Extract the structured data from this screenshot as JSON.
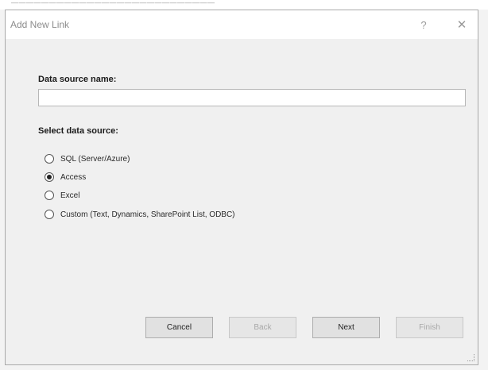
{
  "background_window": {
    "partial_text": "———————————————————————————"
  },
  "dialog": {
    "title": "Add New Link",
    "help_glyph": "?",
    "close_glyph": "✕"
  },
  "form": {
    "name_label": "Data source name:",
    "name_value": "",
    "source_label": "Select data source:",
    "options": [
      {
        "label": "SQL (Server/Azure)",
        "checked": false
      },
      {
        "label": "Access",
        "checked": true
      },
      {
        "label": "Excel",
        "checked": false
      },
      {
        "label": "Custom (Text, Dynamics, SharePoint List, ODBC)",
        "checked": false
      }
    ]
  },
  "buttons": {
    "cancel": "Cancel",
    "back": "Back",
    "next": "Next",
    "finish": "Finish"
  },
  "colors": {
    "dialog_bg": "#f0f0f0",
    "titlebar_bg": "#ffffff",
    "button_bg": "#e1e1e1"
  }
}
